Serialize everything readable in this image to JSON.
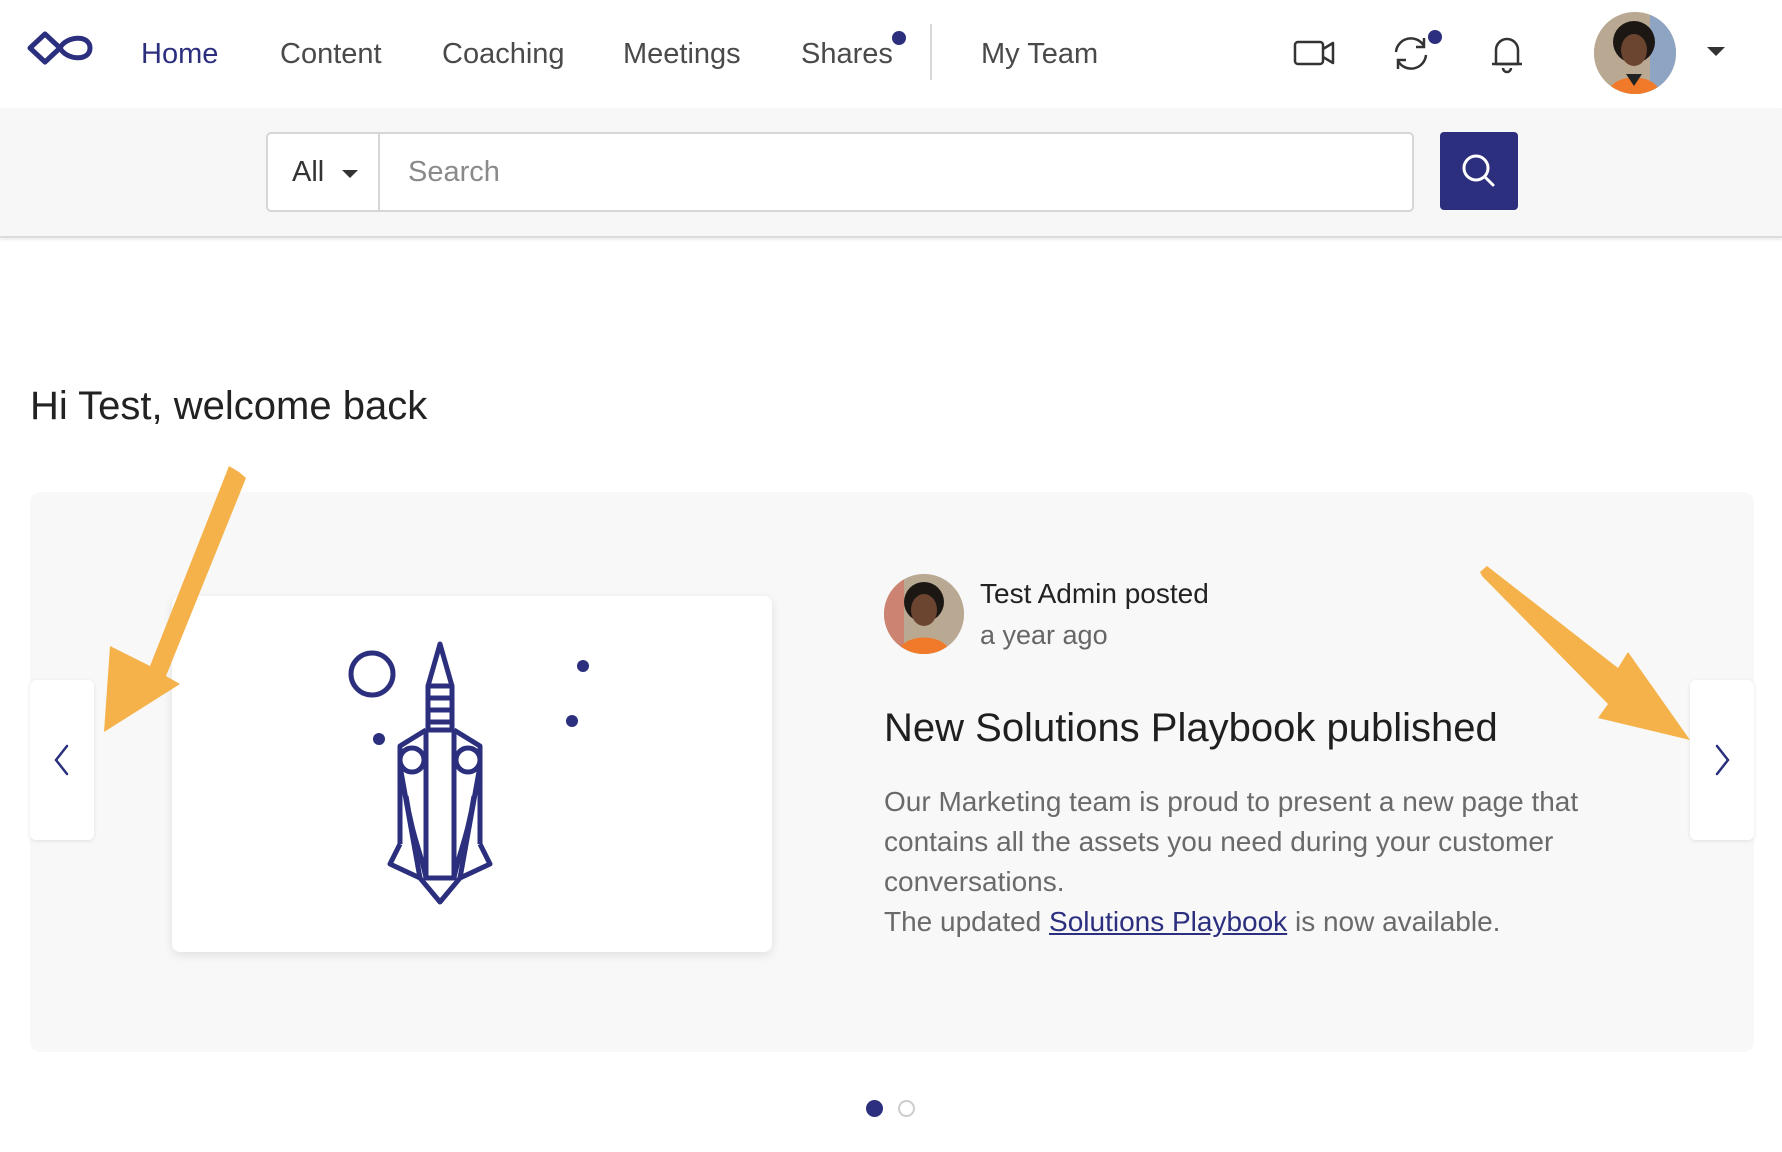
{
  "nav": {
    "items": [
      {
        "label": "Home",
        "active": true
      },
      {
        "label": "Content"
      },
      {
        "label": "Coaching"
      },
      {
        "label": "Meetings"
      },
      {
        "label": "Shares",
        "has_notification_dot": true
      },
      {
        "label": "My Team"
      }
    ],
    "icons": [
      "video-camera-icon",
      "sync-icon",
      "bell-icon"
    ]
  },
  "search": {
    "scope_value": "All",
    "placeholder": "Search"
  },
  "welcome": "Hi Test, welcome back",
  "post": {
    "author": "Test Admin posted",
    "time": "a year ago",
    "title": "New Solutions Playbook published",
    "body_line1": "Our Marketing team is proud to present a new page that contains all the assets you need during your customer conversations.",
    "body_prefix": "The updated ",
    "link_text": "Solutions Playbook",
    "body_suffix": " is now available."
  },
  "carousel": {
    "slide_count": 2,
    "active_slide": 1
  },
  "colors": {
    "brand": "#2b2f7e",
    "annotation_arrow": "#f5b24a",
    "background": "#ffffff",
    "panel": "#f8f8f8"
  }
}
